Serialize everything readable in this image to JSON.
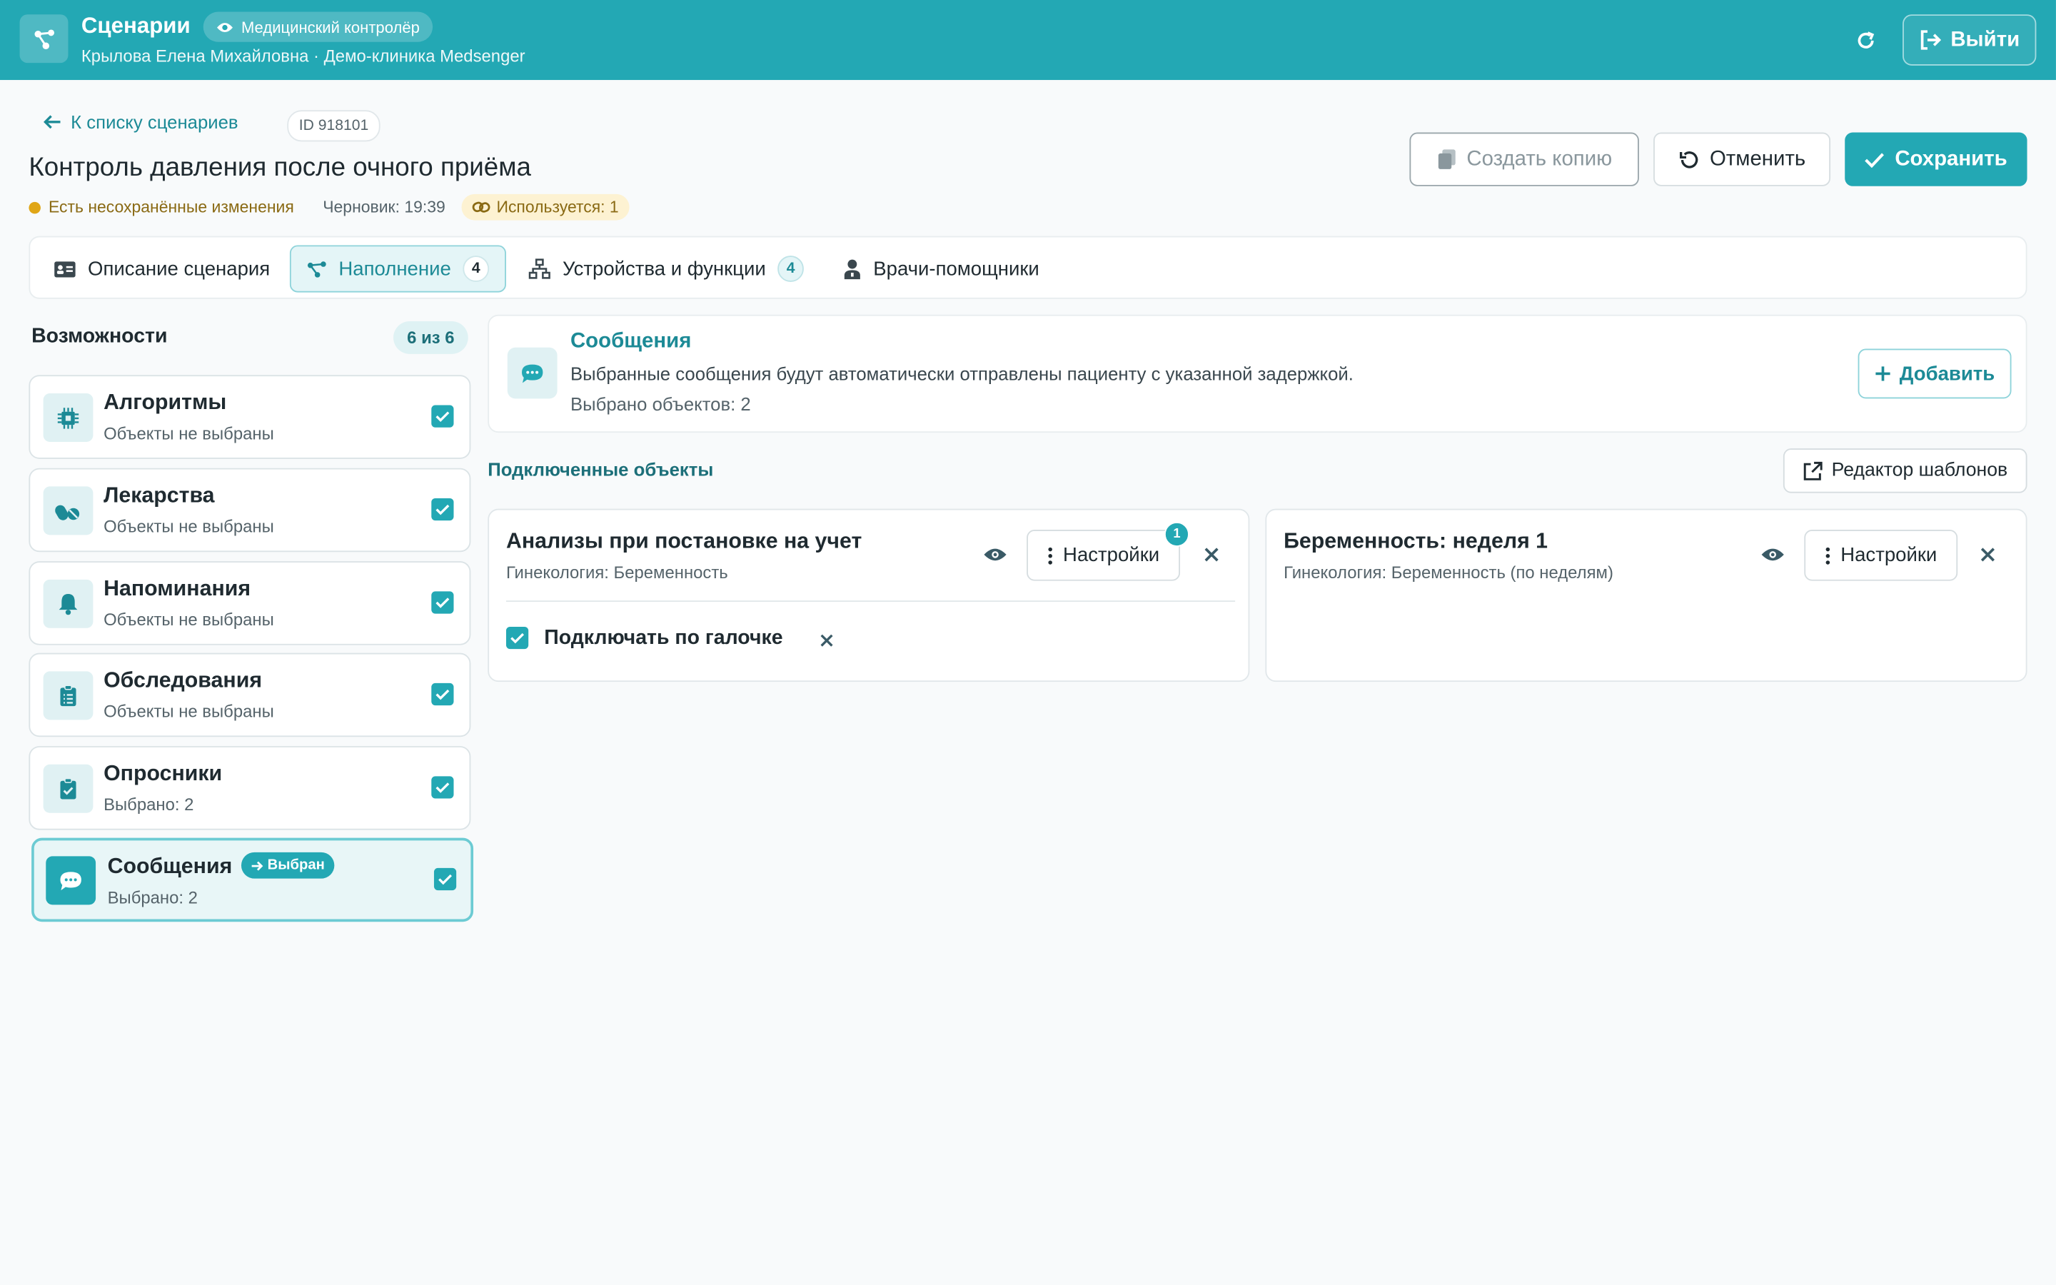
{
  "header": {
    "app_title": "Сценарии",
    "role": "Медицинский контролёр",
    "user_line": "Крылова Елена Михайловна · Демо-клиника Medsenger",
    "logout_label": "Выйти"
  },
  "page": {
    "back_label": "К списку сценариев",
    "id_label": "ID 918101",
    "title": "Контроль давления после очного приёма",
    "unsaved": "Есть несохранённые изменения",
    "draft": "Черновик: 19:39",
    "used": "Используется: 1"
  },
  "actions": {
    "copy": "Создать копию",
    "cancel": "Отменить",
    "save": "Сохранить"
  },
  "tabs": [
    {
      "label": "Описание сценария",
      "count": ""
    },
    {
      "label": "Наполнение",
      "count": "4"
    },
    {
      "label": "Устройства и функции",
      "count": "4"
    },
    {
      "label": "Врачи-помощники",
      "count": ""
    }
  ],
  "capabilities": {
    "title": "Возможности",
    "count": "6 из 6",
    "items": [
      {
        "name": "Алгоритмы",
        "sub": "Объекты не выбраны",
        "icon": "chip-icon"
      },
      {
        "name": "Лекарства",
        "sub": "Объекты не выбраны",
        "icon": "pills-icon"
      },
      {
        "name": "Напоминания",
        "sub": "Объекты не выбраны",
        "icon": "bell-icon"
      },
      {
        "name": "Обследования",
        "sub": "Объекты не выбраны",
        "icon": "clipboard-list-icon"
      },
      {
        "name": "Опросники",
        "sub": "Выбрано: 2",
        "icon": "clipboard-check-icon"
      },
      {
        "name": "Сообщения",
        "sub": "Выбрано: 2",
        "icon": "chat-icon",
        "badge": "Выбран"
      }
    ]
  },
  "messages": {
    "title": "Сообщения",
    "desc": "Выбранные сообщения будут автоматически отправлены пациенту с указанной задержкой.",
    "count": "Выбрано объектов: 2",
    "add_label": "Добавить"
  },
  "connected": {
    "title": "Подключенные объекты",
    "templates_label": "Редактор шаблонов",
    "cards": [
      {
        "title": "Анализы при постановке на учет",
        "sub": "Гинекология: Беременность",
        "settings": "Настройки",
        "notif": "1",
        "option": "Подключать по галочке"
      },
      {
        "title": "Беременность: неделя 1",
        "sub": "Гинекология: Беременность (по неделям)",
        "settings": "Настройки"
      }
    ]
  },
  "colors": {
    "accent": "#23a8b4",
    "accent_dark": "#1c8a96",
    "warning": "#e0a617"
  }
}
